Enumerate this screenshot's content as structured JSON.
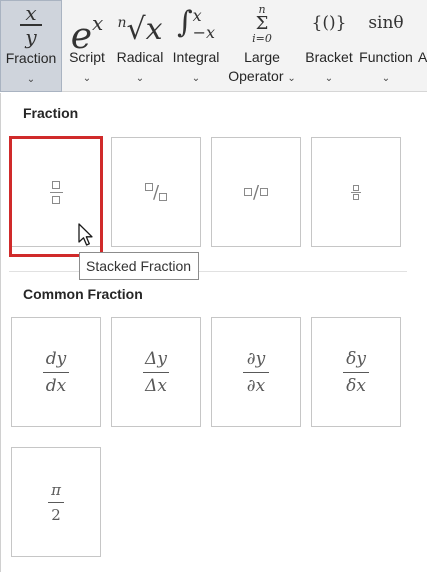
{
  "ribbon": {
    "buttons": [
      {
        "name": "fraction",
        "label": "Fraction"
      },
      {
        "name": "script",
        "label": "Script",
        "icon_text": "e",
        "icon_sup": "x"
      },
      {
        "name": "radical",
        "label": "Radical",
        "icon_index": "n",
        "icon_text": "x"
      },
      {
        "name": "integral",
        "label": "Integral",
        "icon_upper": "x",
        "icon_lower": "−x"
      },
      {
        "name": "large-operator",
        "label_line1": "Large",
        "label_line2": "Operator",
        "icon_upper": "n",
        "icon_lower": "i=0"
      },
      {
        "name": "bracket",
        "label": "Bracket",
        "icon_text": "{()}"
      },
      {
        "name": "function",
        "label": "Function",
        "icon_text": "sinθ"
      },
      {
        "name": "accent",
        "label": "A"
      }
    ],
    "fraction_icon": {
      "top": "x",
      "bottom": "y"
    }
  },
  "gallery": {
    "fraction_title": "Fraction",
    "common_title": "Common Fraction",
    "tooltip": "Stacked Fraction",
    "common": [
      {
        "num": "dy",
        "den": "dx"
      },
      {
        "num": "Δy",
        "den": "Δx"
      },
      {
        "num": "∂y",
        "den": "∂x"
      },
      {
        "num": "δy",
        "den": "δx"
      },
      {
        "num": "π",
        "den": "2"
      }
    ]
  },
  "colors": {
    "highlight": "#d02a2a",
    "ribbon_bg": "#f3f3f3",
    "selected_bg": "#cfd4dc"
  }
}
